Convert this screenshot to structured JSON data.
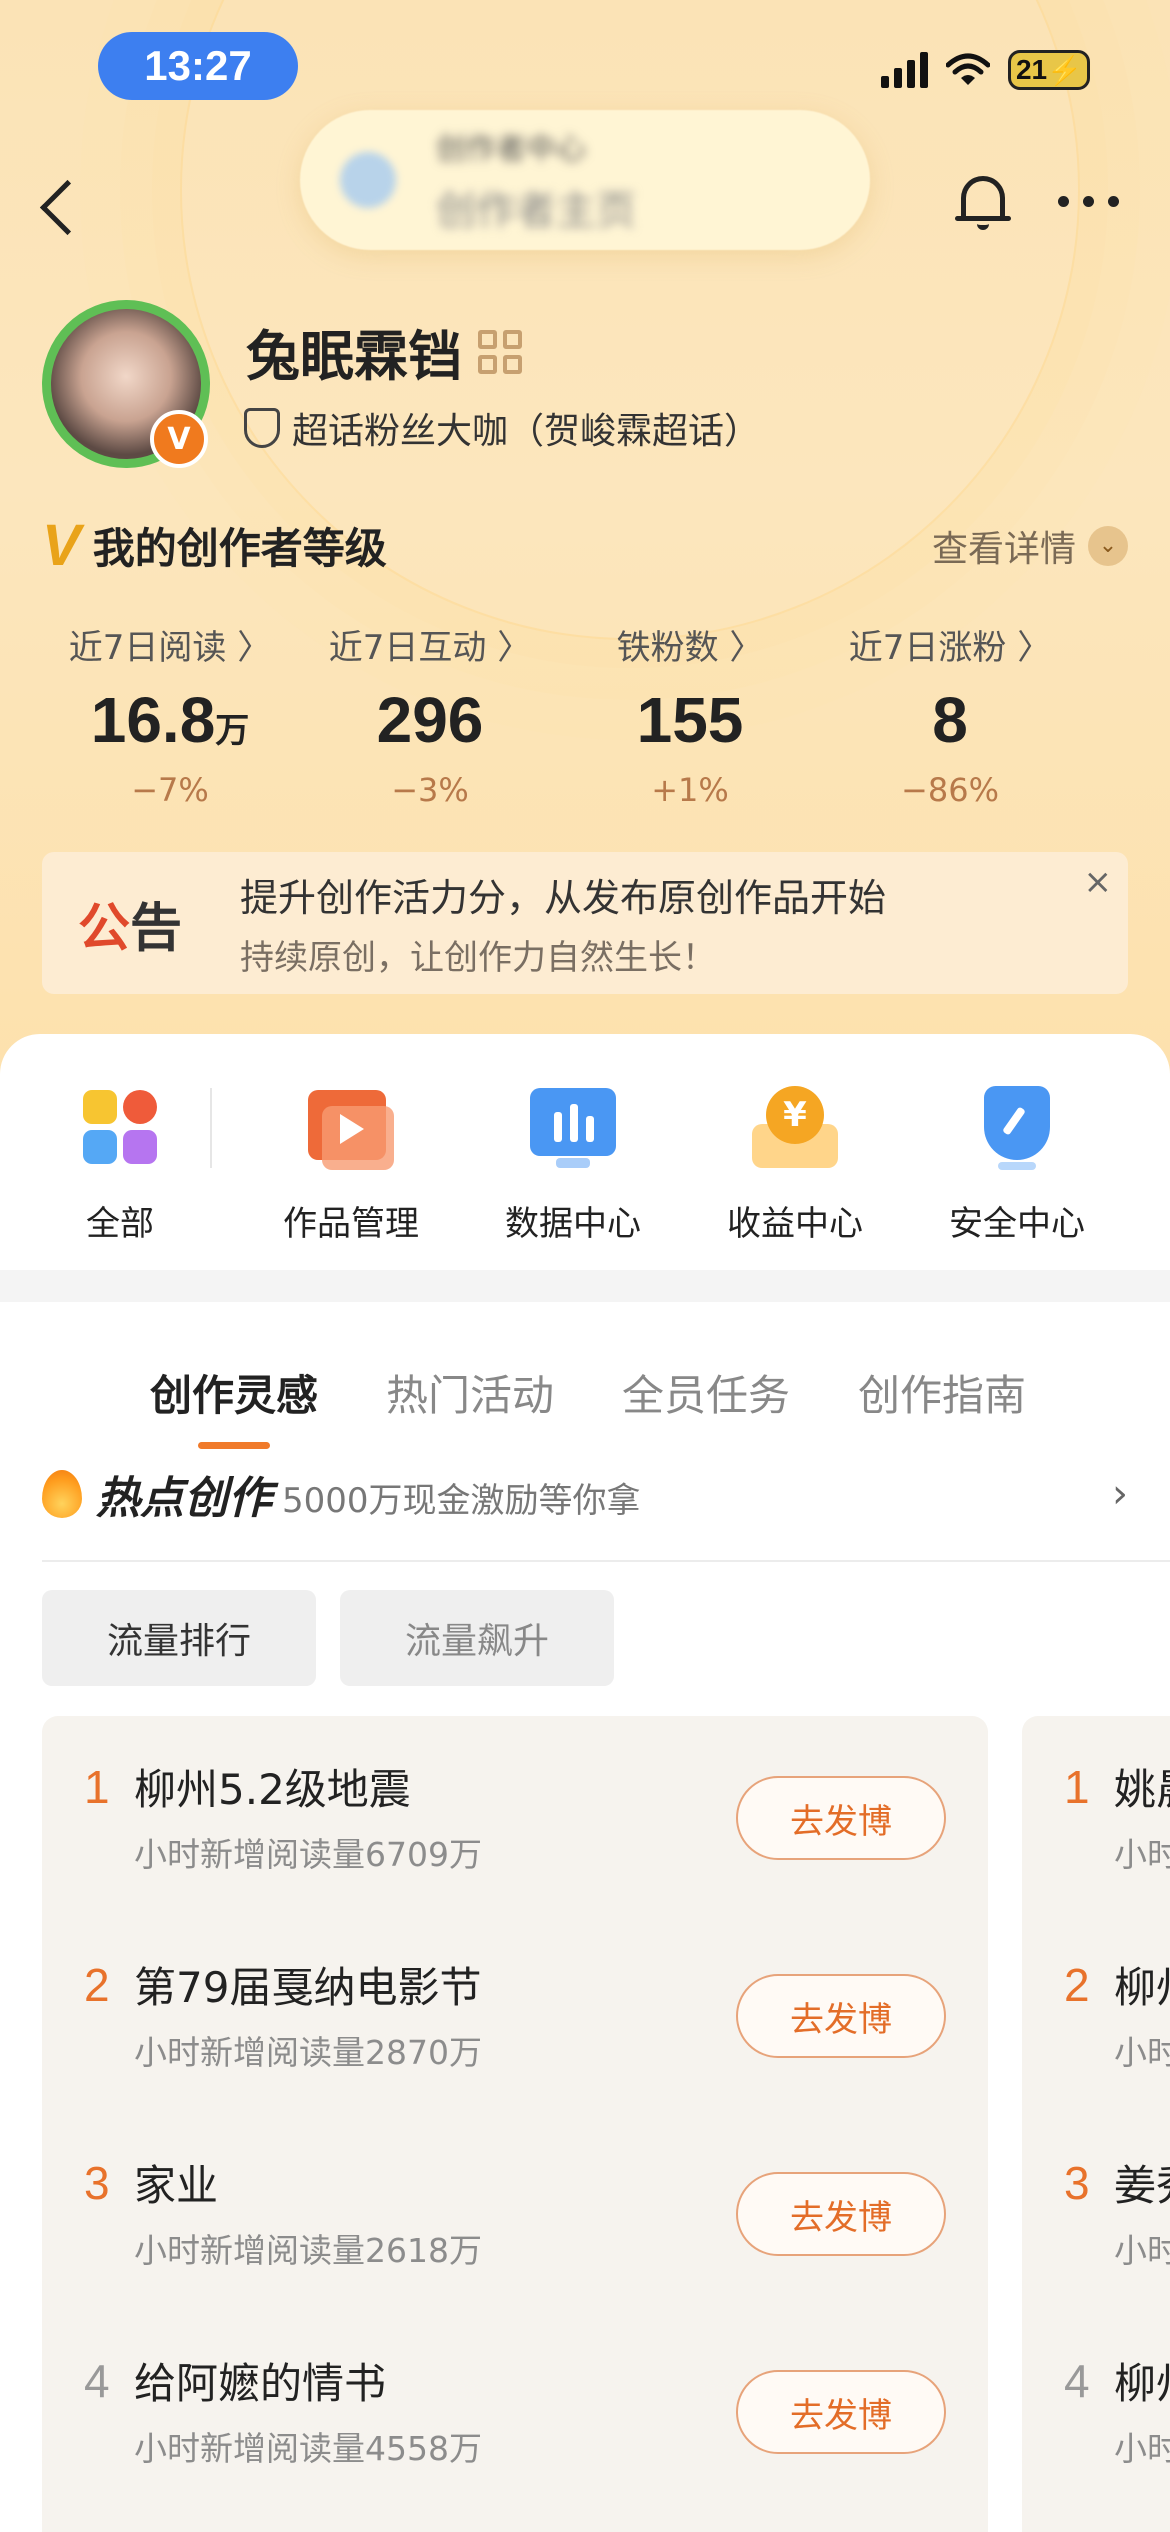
{
  "status_bar": {
    "time": "13:27",
    "battery": "21"
  },
  "header": {
    "blurred_line1": "创作者中心",
    "blurred_line2": "创作者主页"
  },
  "profile": {
    "username": "兔眠霖铛",
    "fan_tag": "超话粉丝大咖（贺峻霖超话）",
    "badge": "V"
  },
  "creator_level": {
    "title": "我的创作者等级",
    "v_mark": "V",
    "detail_label": "查看详情"
  },
  "stats": [
    {
      "label": "近7日阅读 〉",
      "value": "16.8",
      "unit": "万",
      "change": "−7%"
    },
    {
      "label": "近7日互动 〉",
      "value": "296",
      "unit": "",
      "change": "−3%"
    },
    {
      "label": "铁粉数 〉",
      "value": "155",
      "unit": "",
      "change": "+1%"
    },
    {
      "label": "近7日涨粉 〉",
      "value": "8",
      "unit": "",
      "change": "−86%"
    }
  ],
  "notice": {
    "badge_a": "公",
    "badge_b": "告",
    "line1": "提升创作活力分，从发布原创作品开始",
    "line2": "持续原创，让创作力自然生长！",
    "close": "×"
  },
  "tools": [
    {
      "label": "全部",
      "icon": "grid-apps-icon"
    },
    {
      "label": "作品管理",
      "icon": "play-folder-icon"
    },
    {
      "label": "数据中心",
      "icon": "bar-chart-icon"
    },
    {
      "label": "收益中心",
      "icon": "yuan-coin-icon"
    },
    {
      "label": "安全中心",
      "icon": "shield-icon"
    }
  ],
  "tabs": [
    "创作灵感",
    "热门活动",
    "全员任务",
    "创作指南"
  ],
  "hot": {
    "title": "热点创作",
    "subtitle": "5000万现金激励等你拿",
    "chevron": "›"
  },
  "filters": [
    "流量排行",
    "流量飙升"
  ],
  "rank_list": [
    {
      "rank": "1",
      "title": "柳州5.2级地震",
      "sub": "小时新增阅读量6709万",
      "button": "去发博"
    },
    {
      "rank": "2",
      "title": "第79届戛纳电影节",
      "sub": "小时新增阅读量2870万",
      "button": "去发博"
    },
    {
      "rank": "3",
      "title": "家业",
      "sub": "小时新增阅读量2618万",
      "button": "去发博"
    },
    {
      "rank": "4",
      "title": "给阿嬷的情书",
      "sub": "小时新增阅读量4558万",
      "button": "去发博"
    }
  ],
  "peek_list": [
    {
      "rank": "1",
      "title": "姚晨",
      "sub": "小时"
    },
    {
      "rank": "2",
      "title": "柳州",
      "sub": "小时"
    },
    {
      "rank": "3",
      "title": "姜秀",
      "sub": "小时"
    },
    {
      "rank": "4",
      "title": "柳州",
      "sub": "小时"
    }
  ],
  "colors": {
    "rank_top": "#e8722b",
    "rank_other": "#999999",
    "accent": "#f07a2a"
  }
}
